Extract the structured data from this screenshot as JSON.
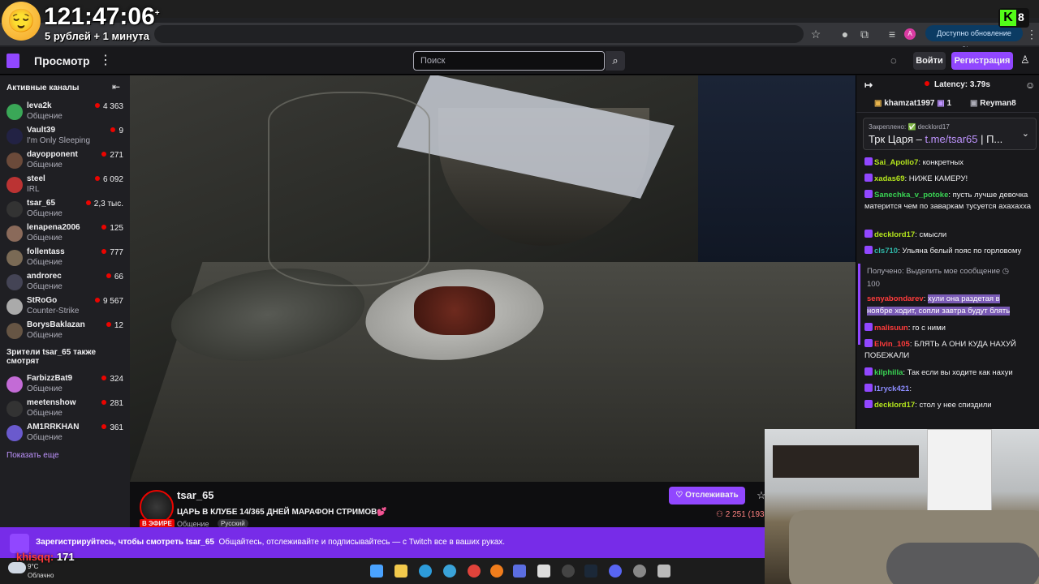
{
  "overlay": {
    "timer": "121:47:06",
    "timer_plus": "+",
    "subtitle": "5 рублей + 1 минута",
    "kick_count": "8"
  },
  "browser": {
    "update_label": "Доступно обновление Chrome",
    "profile_letter": "A"
  },
  "topbar": {
    "browse_label": "Просмотр",
    "search_placeholder": "Поиск",
    "login_label": "Войти",
    "signup_label": "Регистрация"
  },
  "sidebar": {
    "active_header": "Активные каналы",
    "channels": [
      {
        "name": "leva2k",
        "category": "Общение",
        "viewers": "4 363",
        "color": "#3aa757"
      },
      {
        "name": "Vault39",
        "category": "I'm Only Sleeping",
        "viewers": "9",
        "color": "#222244"
      },
      {
        "name": "dayopponent",
        "category": "Общение",
        "viewers": "271",
        "color": "#6b4a3a"
      },
      {
        "name": "steel",
        "category": "IRL",
        "viewers": "6 092",
        "color": "#b33"
      },
      {
        "name": "tsar_65",
        "category": "Общение",
        "viewers": "2,3 тыс.",
        "color": "#333"
      },
      {
        "name": "lenapena2006",
        "category": "Общение",
        "viewers": "125",
        "color": "#8a6a5a"
      },
      {
        "name": "follentass",
        "category": "Общение",
        "viewers": "777",
        "color": "#7a6a55"
      },
      {
        "name": "androrec",
        "category": "Общение",
        "viewers": "66",
        "color": "#445"
      },
      {
        "name": "StRoGo",
        "category": "Counter-Strike",
        "viewers": "9 567",
        "color": "#aaa"
      },
      {
        "name": "BorysBaklazan",
        "category": "Общение",
        "viewers": "12",
        "color": "#665544"
      }
    ],
    "also_watch_header_line1": "Зрители tsar_65 также",
    "also_watch_header_line2": "смотрят",
    "also_watch": [
      {
        "name": "FarbizzBat9",
        "category": "Общение",
        "viewers": "324",
        "color": "#c36bd6"
      },
      {
        "name": "meetenshow",
        "category": "Общение",
        "viewers": "281",
        "color": "#333"
      },
      {
        "name": "AM1RRKHAN",
        "category": "Общение",
        "viewers": "361",
        "color": "#6a5acd"
      }
    ],
    "show_more": "Показать еще"
  },
  "stream": {
    "streamer": "tsar_65",
    "title": "ЦАРЬ В КЛУБЕ 14/365 ДНЕЙ МАРАФОН СТРИМОВ💕",
    "live_label": "В ЭФИРЕ",
    "category": "Общение",
    "language": "Русский",
    "follow_label": "Отслеживать",
    "viewers": "2 251 (193"
  },
  "chat": {
    "latency": "Latency: 3.79s",
    "gifters": [
      {
        "name": "khamzat1997",
        "count": "1"
      },
      {
        "name": "Reyman8",
        "count": ""
      }
    ],
    "pinned_label": "Закреплено: ✅ decklord17",
    "pinned_prefix": "Трк Царя – ",
    "pinned_link": "t.me/tsar65",
    "pinned_suffix": " | П...",
    "messages": [
      {
        "user": "Sai_Apollo7",
        "color": "#b5e61d",
        "text": "конкретных"
      },
      {
        "user": "xadas69",
        "color": "#b5e61d",
        "text": "НИЖЕ КАМЕРУ!"
      },
      {
        "user": "Sanechka_v_potoke",
        "color": "#39d353",
        "text": "пусть лучше девочка матерится чем по заваркам тусуется ахахахха"
      },
      {
        "user": "decklord17",
        "color": "#b5e61d",
        "text": "смысли"
      },
      {
        "user": "cls710",
        "color": "#2fb7a8",
        "text": "Ульяна белый пояс по горловому"
      }
    ],
    "reward_note": "Получено: Выделить мое сообщение",
    "reward_cost": "100",
    "reward_user": "senyabondarev",
    "reward_text": "хули она раздетая в ноябре ходит, сопли завтра будут блять",
    "messages2": [
      {
        "user": "malisuun",
        "color": "#ff3b3b",
        "text": "го с ними"
      },
      {
        "user": "Elvin_105",
        "color": "#ff3b3b",
        "text": "БЛЯТЬ А ОНИ КУДА НАХУЙ ПОБЕЖАЛИ"
      },
      {
        "user": "kilphilla",
        "color": "#39d353",
        "text": "Так если вы ходите как нахуи"
      },
      {
        "user": "l1ryck421",
        "color": "#8c8cff",
        "text": ""
      },
      {
        "user": "decklord17",
        "color": "#b5e61d",
        "text": "стол у нее спиздили"
      }
    ]
  },
  "banner": {
    "text_bold": "Зарегистрируйтесь, чтобы смотреть tsar_65",
    "text_rest": "Общайтесь, отслеживайте и подписывайтесь — с Twitch все в ваших руках."
  },
  "gifter_overlay": {
    "name": "khisqq:",
    "amount": "171"
  },
  "taskbar": {
    "temp": "9°C",
    "weather": "Облачно"
  }
}
